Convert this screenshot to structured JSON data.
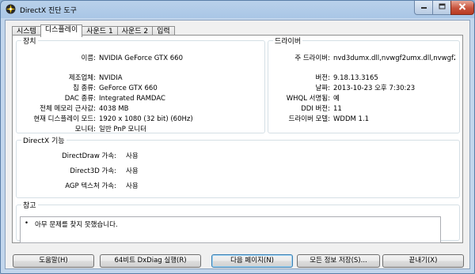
{
  "window": {
    "title": "DirectX 진단 도구"
  },
  "tabs": [
    {
      "label": "시스템"
    },
    {
      "label": "디스플레이"
    },
    {
      "label": "사운드 1"
    },
    {
      "label": "사운드 2"
    },
    {
      "label": "입력"
    }
  ],
  "device": {
    "legend": "장치",
    "rows": [
      {
        "label": "이름:",
        "value": "NVIDIA GeForce GTX 660"
      },
      {
        "label": "제조업체:",
        "value": "NVIDIA"
      },
      {
        "label": "칩 종류:",
        "value": "GeForce GTX 660"
      },
      {
        "label": "DAC 종류:",
        "value": "Integrated RAMDAC"
      },
      {
        "label": "전체 메모리 근사값:",
        "value": "4038 MB"
      },
      {
        "label": "현재 디스플레이 모드:",
        "value": "1920 x 1080 (32 bit) (60Hz)"
      },
      {
        "label": "모니터:",
        "value": "일반 PnP 모니터"
      }
    ]
  },
  "drivers": {
    "legend": "드라이버",
    "rows": [
      {
        "label": "주 드라이버:",
        "value": "nvd3dumx.dll,nvwgf2umx.dll,nvwgf2u"
      },
      {
        "label": "버전:",
        "value": "9.18.13.3165"
      },
      {
        "label": "날짜:",
        "value": "2013-10-23 오후 7:30:23"
      },
      {
        "label": "WHQL 서명됨:",
        "value": "예"
      },
      {
        "label": "DDI 버전:",
        "value": "11"
      },
      {
        "label": "드라이버 모델:",
        "value": "WDDM 1.1"
      }
    ]
  },
  "directx": {
    "legend": "DirectX 기능",
    "rows": [
      {
        "label": "DirectDraw 가속:",
        "value": "사용"
      },
      {
        "label": "Direct3D 가속:",
        "value": "사용"
      },
      {
        "label": "AGP 텍스처 가속:",
        "value": "사용"
      }
    ]
  },
  "notes": {
    "legend": "참고",
    "items": [
      {
        "bullet": "•",
        "text": "아무 문제를 찾지 못했습니다."
      }
    ]
  },
  "buttons": {
    "help": "도움말(H)",
    "dxdiag64": "64비트 DxDiag 실행(R)",
    "next_page": "다음 페이지(N)",
    "save_all": "모든 정보 저장(S)...",
    "exit": "끝내기(X)"
  },
  "colors": {
    "titlebar": "#a9c6e6",
    "close_button": "#c7533c",
    "client_bg": "#f0f0f0",
    "group_border": "#d5dfe5"
  },
  "icons": {
    "app": "directx-icon",
    "minimize": "minimize-icon",
    "maximize": "maximize-icon",
    "close": "close-icon"
  }
}
